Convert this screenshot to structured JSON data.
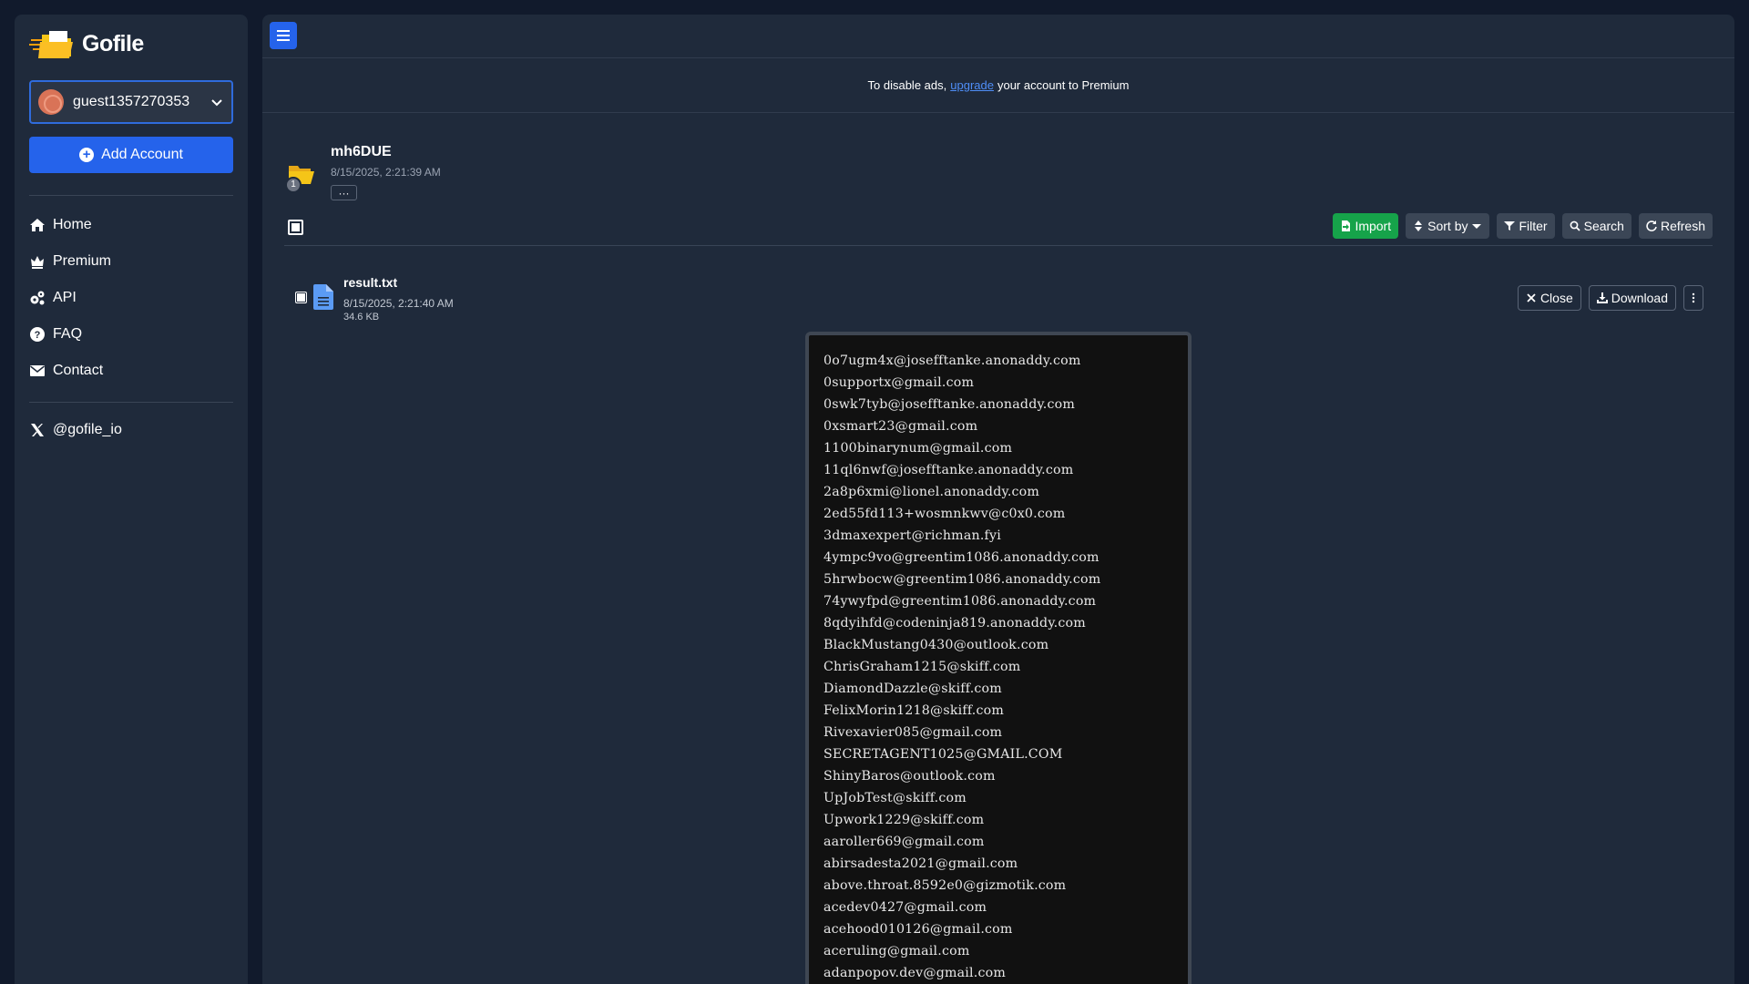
{
  "app": {
    "name": "Gofile"
  },
  "account": {
    "name": "guest1357270353"
  },
  "sidebar": {
    "add_account_label": "Add Account",
    "nav": [
      {
        "label": "Home",
        "icon": "home-icon"
      },
      {
        "label": "Premium",
        "icon": "crown-icon"
      },
      {
        "label": "API",
        "icon": "gears-icon"
      },
      {
        "label": "FAQ",
        "icon": "question-circle-icon"
      },
      {
        "label": "Contact",
        "icon": "envelope-icon"
      }
    ],
    "social": {
      "label": "@gofile_io",
      "icon": "x-logo-icon"
    }
  },
  "adbar": {
    "before": "To disable ads,",
    "link": "upgrade",
    "after": "your account to Premium"
  },
  "folder": {
    "name": "mh6DUE",
    "date": "8/15/2025, 2:21:39 AM",
    "badge": "1",
    "more_label": "···"
  },
  "toolbar": {
    "import_label": "Import",
    "sort_label": "Sort by",
    "filter_label": "Filter",
    "search_label": "Search",
    "refresh_label": "Refresh"
  },
  "file": {
    "name": "result.txt",
    "date": "8/15/2025, 2:21:40 AM",
    "size": "34.6 KB",
    "close_label": "Close",
    "download_label": "Download"
  },
  "preview": {
    "lines": [
      "0o7ugm4x@josefftanke.anonaddy.com",
      "0supportx@gmail.com",
      "0swk7tyb@josefftanke.anonaddy.com",
      "0xsmart23@gmail.com",
      "1100binarynum@gmail.com",
      "11ql6nwf@josefftanke.anonaddy.com",
      "2a8p6xmi@lionel.anonaddy.com",
      "2ed55fd113+wosmnkwv@c0x0.com",
      "3dmaxexpert@richman.fyi",
      "4ympc9vo@greentim1086.anonaddy.com",
      "5hrwbocw@greentim1086.anonaddy.com",
      "74ywyfpd@greentim1086.anonaddy.com",
      "8qdyihfd@codeninja819.anonaddy.com",
      "BlackMustang0430@outlook.com",
      "ChrisGraham1215@skiff.com",
      "DiamondDazzle@skiff.com",
      "FelixMorin1218@skiff.com",
      "Rivexavier085@gmail.com",
      "SECRETAGENT1025@GMAIL.COM",
      "ShinyBaros@outlook.com",
      "UpJobTest@skiff.com",
      "Upwork1229@skiff.com",
      "aaroller669@gmail.com",
      "abirsadesta2021@gmail.com",
      "above.throat.8592e0@gizmotik.com",
      "acedev0427@gmail.com",
      "acehood010126@gmail.com",
      "aceruling@gmail.com",
      "adanpopov.dev@gmail.com"
    ]
  },
  "colors": {
    "accent": "#2563eb",
    "import": "#16a34a",
    "panel": "#1f2a3b",
    "background": "#111a2c"
  }
}
